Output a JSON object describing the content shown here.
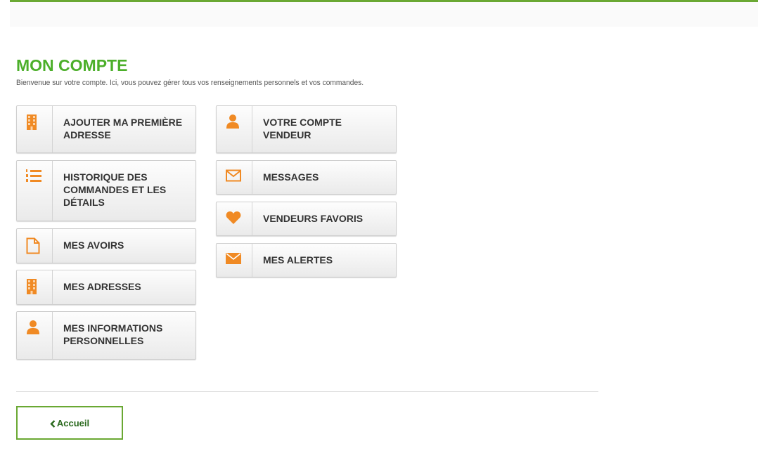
{
  "colors": {
    "accent_green": "#4caf2a",
    "border_green": "#6aa833",
    "icon_orange": "#f08a24"
  },
  "header": {
    "title": "MON COMPTE",
    "subtitle": "Bienvenue sur votre compte. Ici, vous pouvez gérer tous vos renseignements personnels et vos commandes."
  },
  "tiles": [
    {
      "icon": "building-icon",
      "label": "AJOUTER MA PREMIÈRE ADRESSE"
    },
    {
      "icon": "ordered-list-icon",
      "label": "HISTORIQUE DES COMMANDES ET LES DÉTAILS"
    },
    {
      "icon": "document-icon",
      "label": "MES AVOIRS"
    },
    {
      "icon": "building-icon",
      "label": "MES ADRESSES"
    },
    {
      "icon": "user-icon",
      "label": "MES INFORMATIONS PERSONNELLES"
    },
    {
      "icon": "user-icon",
      "label": "VOTRE COMPTE VENDEUR"
    },
    {
      "icon": "envelope-outline-icon",
      "label": "MESSAGES"
    },
    {
      "icon": "heart-icon",
      "label": "VENDEURS FAVORIS"
    },
    {
      "icon": "envelope-filled-icon",
      "label": "MES ALERTES"
    }
  ],
  "footer": {
    "home_label": "Accueil",
    "home_icon": "chevron-left-icon"
  }
}
